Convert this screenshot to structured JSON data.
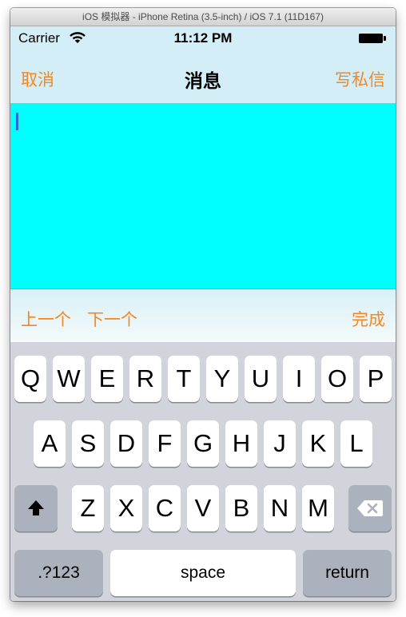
{
  "window": {
    "title": "iOS 模拟器 - iPhone Retina (3.5-inch) / iOS 7.1 (11D167)"
  },
  "status_bar": {
    "carrier": "Carrier",
    "time": "11:12 PM"
  },
  "nav": {
    "cancel": "取消",
    "title": "消息",
    "compose": "写私信"
  },
  "editor": {
    "text": "",
    "background": "#00ffff"
  },
  "accessory": {
    "prev": "上一个",
    "next": "下一个",
    "done": "完成"
  },
  "keyboard": {
    "row1": [
      "Q",
      "W",
      "E",
      "R",
      "T",
      "Y",
      "U",
      "I",
      "O",
      "P"
    ],
    "row2": [
      "A",
      "S",
      "D",
      "F",
      "G",
      "H",
      "J",
      "K",
      "L"
    ],
    "row3": [
      "Z",
      "X",
      "C",
      "V",
      "B",
      "N",
      "M"
    ],
    "numbers": ".?123",
    "space": "space",
    "return": "return"
  },
  "colors": {
    "accent": "#f5871f",
    "nav_background": "#d3eef6",
    "keyboard_background": "#d1d4da"
  }
}
